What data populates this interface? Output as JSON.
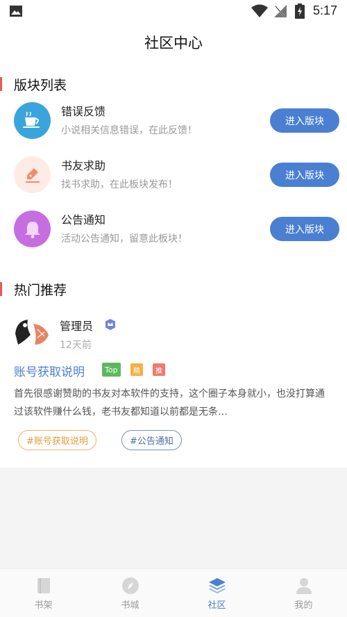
{
  "status_bar": {
    "time": "5:17"
  },
  "page_title": "社区中心",
  "sections": {
    "forums_title": "版块列表",
    "hot_title": "热门推荐"
  },
  "forums": [
    {
      "name": "错误反馈",
      "desc": "小说相关信息错误，在此反馈！",
      "button": "进入版块",
      "icon": "coffee-cup-icon",
      "color": "#3aa5dc"
    },
    {
      "name": "书友求助",
      "desc": "找书求助，在此板块发布！",
      "button": "进入版块",
      "icon": "pencil-icon",
      "color": "#f28b6b"
    },
    {
      "name": "公告通知",
      "desc": "活动公告通知，留意此板块！",
      "button": "进入版块",
      "icon": "bell-icon",
      "color": "#c66ee0"
    }
  ],
  "post": {
    "author": "管理员",
    "time": "12天前",
    "title": "账号获取说明",
    "tags": {
      "top": "Top",
      "jing": "精",
      "tui": "推"
    },
    "excerpt": "首先很感谢赞助的书友对本软件的支持，这个圈子本身就小，也没打算通过该软件赚什么钱，老书友都知道以前都是无条…",
    "topics": [
      "#账号获取说明",
      "#公告通知"
    ]
  },
  "tabbar": {
    "items": [
      {
        "label": "书架",
        "icon": "bookshelf-icon",
        "active": false
      },
      {
        "label": "书城",
        "icon": "compass-icon",
        "active": false
      },
      {
        "label": "社区",
        "icon": "layers-icon",
        "active": true
      },
      {
        "label": "我的",
        "icon": "user-icon",
        "active": false
      }
    ]
  },
  "colors": {
    "accent": "#4a7fd1",
    "section_bar": "#e85a5a"
  }
}
